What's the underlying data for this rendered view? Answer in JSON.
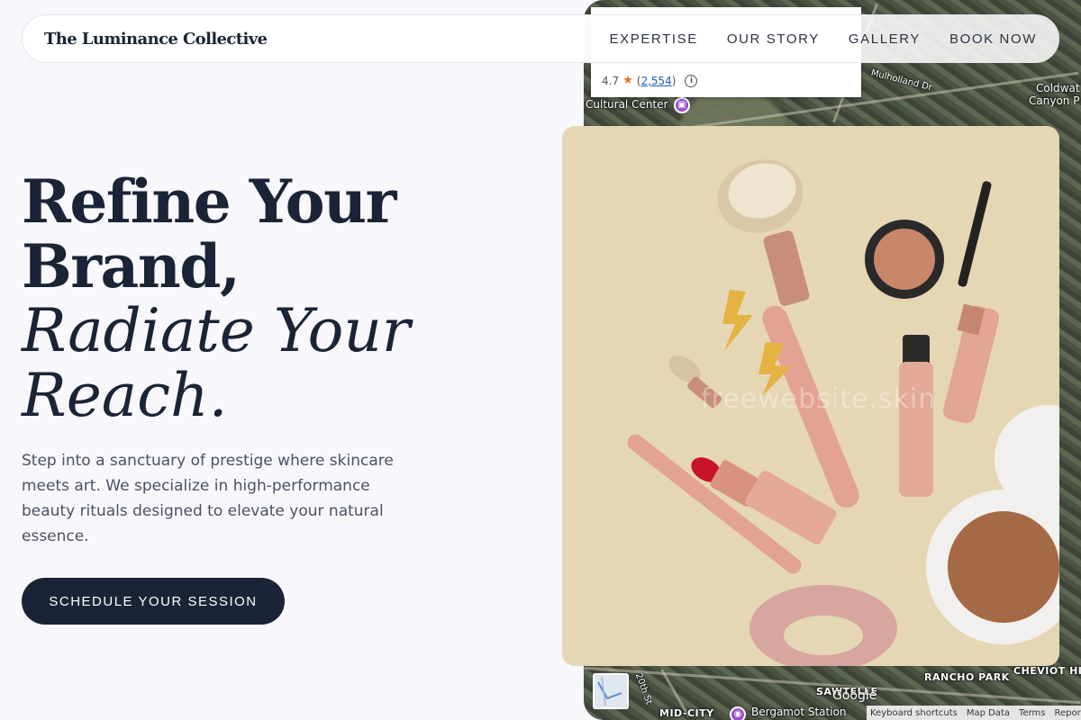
{
  "nav": {
    "brand": "The Luminance Collective",
    "links": [
      "EXPERTISE",
      "OUR STORY",
      "GALLERY",
      "BOOK NOW"
    ]
  },
  "hero": {
    "title_line1": "Refine Your",
    "title_line2": "Brand,",
    "title_line3": "Radiate Your",
    "title_line4": "Reach.",
    "text": "Step into a sanctuary of prestige where skincare meets art. We specialize in high-performance beauty rituals designed to elevate your natural essence.",
    "cta": "SCHEDULE YOUR SESSION"
  },
  "product_image": {
    "watermark": "freewebsite.skin"
  },
  "map": {
    "rating": "4.7",
    "review_count": "2,554",
    "labels": {
      "cultural_center": "Cultural Center",
      "mulholland": "Mulholland Dr",
      "coldwater_1": "Coldwat",
      "coldwater_2": "Canyon P",
      "bergamot": "Bergamot Station",
      "mid_city": "MID-CITY",
      "rancho_park": "RANCHO PARK",
      "cheviot": "CHEVIOT HIL",
      "sawtelle": "SAWTELLE",
      "street_20th": "20th St"
    },
    "google": "Google",
    "footer": [
      "Keyboard shortcuts",
      "Map Data",
      "Terms",
      "Report a"
    ]
  },
  "colors": {
    "navy": "#1b2436",
    "bg": "#f8f7fc",
    "product_bg": "#e5d6b4",
    "accent_pin": "#9b4fd0"
  }
}
